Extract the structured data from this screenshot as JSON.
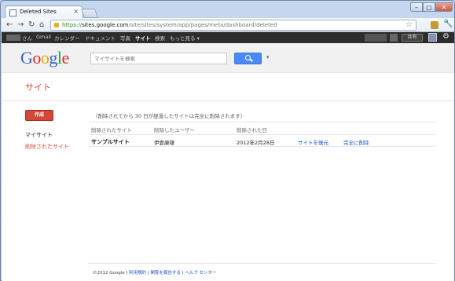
{
  "browser": {
    "tab_title": "Deleted Sites",
    "tab_close": "×",
    "url_scheme": "https://",
    "url_host": "sites.google.com",
    "url_path": "/site/sites/system/app/pages/meta/dashboard/deleted",
    "window_min": "–",
    "window_max": "□",
    "window_close": "✕"
  },
  "gbar": {
    "items": [
      "さん",
      "Gmail",
      "カレンダー",
      "ドキュメント",
      "写真",
      "サイト",
      "検索",
      "もっと見る ▾"
    ],
    "active_item": "サイト",
    "share_label": "共有"
  },
  "header": {
    "logo": {
      "G": "G",
      "o1": "o",
      "o2": "o",
      "g": "g",
      "l": "l",
      "e": "e"
    },
    "search_placeholder": "マイサイトを検索",
    "search_dropdown": "▾"
  },
  "page_title": "サイト",
  "sidebar": {
    "create_label": "作成",
    "my_sites": "マイサイト",
    "deleted_sites": "削除されたサイト"
  },
  "main": {
    "notice": "（削除されてから 30 日が経過したサイトは完全に削除されます）",
    "columns": [
      "削除されたサイト",
      "削除したユーザー",
      "削除された日"
    ],
    "rows": [
      {
        "site": "サンプルサイト",
        "user": "伊倉康雄",
        "date": "2012年2月28日",
        "restore": "サイトを復元",
        "delete": "完全に削除"
      }
    ]
  },
  "footer": {
    "copyright": "©2012 Google",
    "sep": " | ",
    "terms": "利用規約",
    "report": "関覧を報告する",
    "help": "ヘルプ センター"
  }
}
